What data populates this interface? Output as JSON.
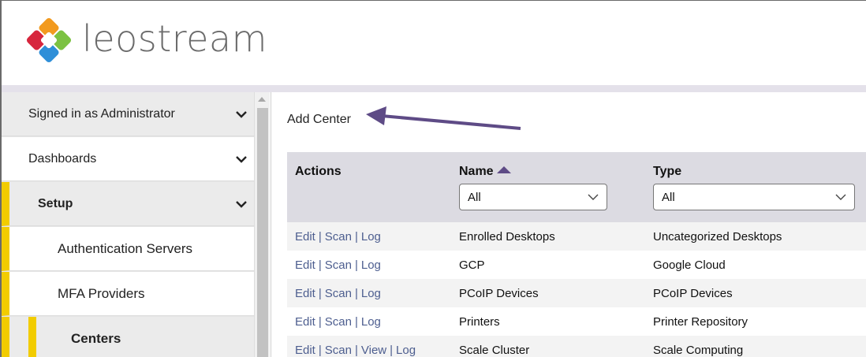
{
  "app": {
    "logo_text": "leostream"
  },
  "sidebar": {
    "items": [
      {
        "label": "Signed in as Administrator",
        "expandable": true
      },
      {
        "label": "Dashboards",
        "expandable": true
      },
      {
        "label": "Setup",
        "expandable": true
      },
      {
        "label": "Authentication Servers",
        "expandable": false
      },
      {
        "label": "MFA Providers",
        "expandable": false
      },
      {
        "label": "Centers",
        "expandable": false
      }
    ],
    "accent_color": "#f2cc00"
  },
  "main": {
    "add_center_label": "Add Center",
    "arrow_color": "#5e4b86",
    "table": {
      "headers": {
        "actions": "Actions",
        "name": "Name",
        "type": "Type"
      },
      "filters": {
        "name": "All",
        "type": "All"
      },
      "rows": [
        {
          "actions": [
            "Edit",
            "Scan",
            "Log"
          ],
          "name": "Enrolled Desktops",
          "type": "Uncategorized Desktops"
        },
        {
          "actions": [
            "Edit",
            "Scan",
            "Log"
          ],
          "name": "GCP",
          "type": "Google Cloud"
        },
        {
          "actions": [
            "Edit",
            "Scan",
            "Log"
          ],
          "name": "PCoIP Devices",
          "type": "PCoIP Devices"
        },
        {
          "actions": [
            "Edit",
            "Scan",
            "Log"
          ],
          "name": "Printers",
          "type": "Printer Repository"
        },
        {
          "actions": [
            "Edit",
            "Scan",
            "View",
            "Log"
          ],
          "name": "Scale Cluster",
          "type": "Scale Computing"
        }
      ]
    }
  }
}
